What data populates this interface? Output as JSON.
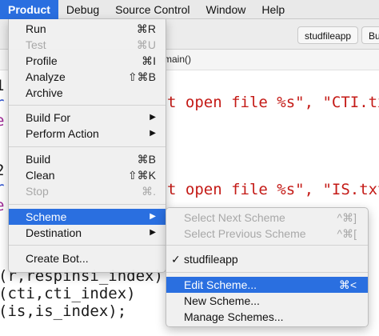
{
  "menubar": {
    "items": [
      {
        "label": "Product"
      },
      {
        "label": "Debug"
      },
      {
        "label": "Source Control"
      },
      {
        "label": "Window"
      },
      {
        "label": "Help"
      }
    ]
  },
  "tabs": {
    "active_tab": "studfileapp",
    "next_tab": "Bu"
  },
  "jumpbar": {
    "function": "main()"
  },
  "code": {
    "line1_prefix": "t open file %s\", ",
    "line1_str": "\"CTI.tx",
    "line2_prefix": "t open file %s\", ",
    "line2_str": "\"IS.txt",
    "line3": "(r,respinsi_index)",
    "line4": "(cti,cti_index)",
    "line5": "(is,is_index);",
    "gutter": [
      "1",
      "r",
      "e",
      "2",
      "r",
      "e"
    ]
  },
  "product_menu": {
    "items": {
      "run": {
        "label": "Run",
        "shortcut": "⌘R"
      },
      "test": {
        "label": "Test",
        "shortcut": "⌘U"
      },
      "profile": {
        "label": "Profile",
        "shortcut": "⌘I"
      },
      "analyze": {
        "label": "Analyze",
        "shortcut": "⇧⌘B"
      },
      "archive": {
        "label": "Archive"
      },
      "build_for": {
        "label": "Build For"
      },
      "perform_action": {
        "label": "Perform Action"
      },
      "build": {
        "label": "Build",
        "shortcut": "⌘B"
      },
      "clean": {
        "label": "Clean",
        "shortcut": "⇧⌘K"
      },
      "stop": {
        "label": "Stop",
        "shortcut": "⌘."
      },
      "scheme": {
        "label": "Scheme"
      },
      "destination": {
        "label": "Destination"
      },
      "create_bot": {
        "label": "Create Bot..."
      }
    },
    "submenu_arrow": "▶"
  },
  "scheme_menu": {
    "items": {
      "select_next": {
        "label": "Select Next Scheme",
        "shortcut": "^⌘]"
      },
      "select_prev": {
        "label": "Select Previous Scheme",
        "shortcut": "^⌘["
      },
      "current": {
        "label": "studfileapp",
        "check": "✓"
      },
      "edit": {
        "label": "Edit Scheme...",
        "shortcut": "⌘<"
      },
      "new": {
        "label": "New Scheme..."
      },
      "manage": {
        "label": "Manage Schemes..."
      }
    }
  },
  "colors": {
    "accent": "#2a6fe0",
    "string": "#c41a16",
    "menu_bg": "#f0f0f0"
  }
}
